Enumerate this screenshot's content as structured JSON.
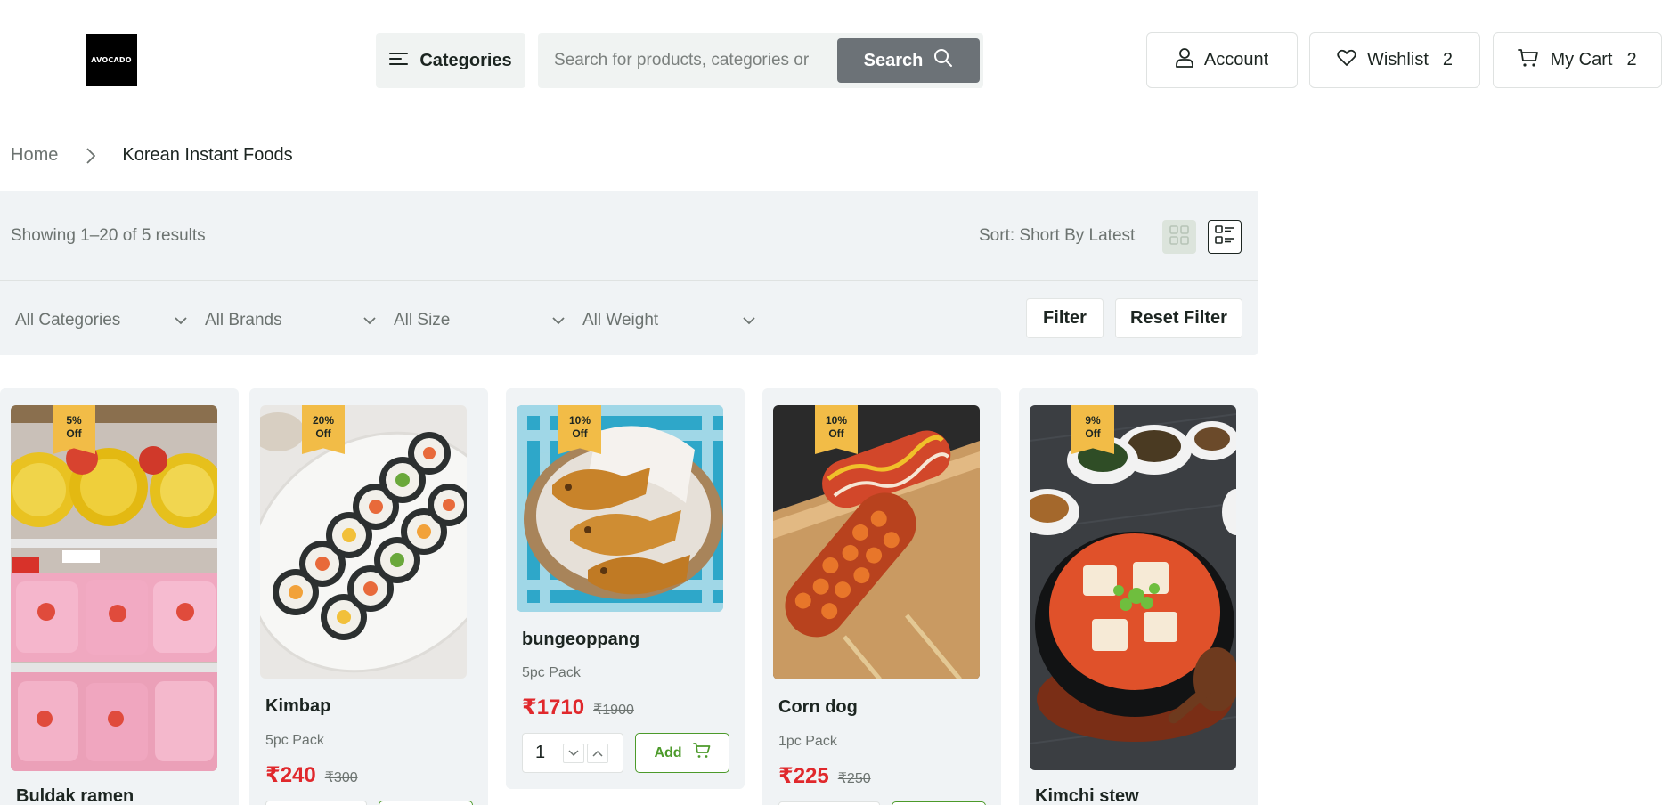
{
  "header": {
    "logo_text": "AVOCADO",
    "categories_label": "Categories",
    "search_placeholder": "Search for products, categories or",
    "search_button": "Search",
    "account_label": "Account",
    "wishlist_label": "Wishlist",
    "wishlist_count": "2",
    "cart_label": "My Cart",
    "cart_count": "2"
  },
  "breadcrumb": {
    "home": "Home",
    "current": "Korean Instant Foods"
  },
  "toolbar": {
    "showing": "Showing 1–20 of 5 results",
    "sort": "Sort: Short By Latest",
    "filters": {
      "category": "All Categories",
      "brand": "All Brands",
      "size": "All Size",
      "weight": "All Weight"
    },
    "filter_button": "Filter",
    "reset_button": "Reset Filter"
  },
  "products": [
    {
      "name": "Buldak ramen",
      "badge_pct": "5%",
      "badge_off": "Off",
      "image": "ramen-shelf-photo"
    },
    {
      "name": "Kimbap",
      "badge_pct": "20%",
      "badge_off": "Off",
      "pack": "5pc Pack",
      "price": "₹240",
      "old_price": "₹300",
      "image": "kimbap-plate-photo"
    },
    {
      "name": "bungeoppang",
      "badge_pct": "10%",
      "badge_off": "Off",
      "pack": "5pc Pack",
      "price": "₹1710",
      "old_price": "₹1900",
      "qty": "1",
      "add_label": "Add",
      "image": "fish-pastry-photo"
    },
    {
      "name": "Corn dog",
      "badge_pct": "10%",
      "badge_off": "Off",
      "pack": "1pc Pack",
      "price": "₹225",
      "old_price": "₹250",
      "image": "corn-dog-photo"
    },
    {
      "name": "Kimchi stew",
      "badge_pct": "9%",
      "badge_off": "Off",
      "image": "kimchi-stew-photo"
    }
  ],
  "colors": {
    "panel_bg": "#f0f3f5",
    "badge": "#f2bc47",
    "price_red": "#e0282c",
    "add_green": "#4c9a2a",
    "search_button_bg": "#6c7277"
  }
}
